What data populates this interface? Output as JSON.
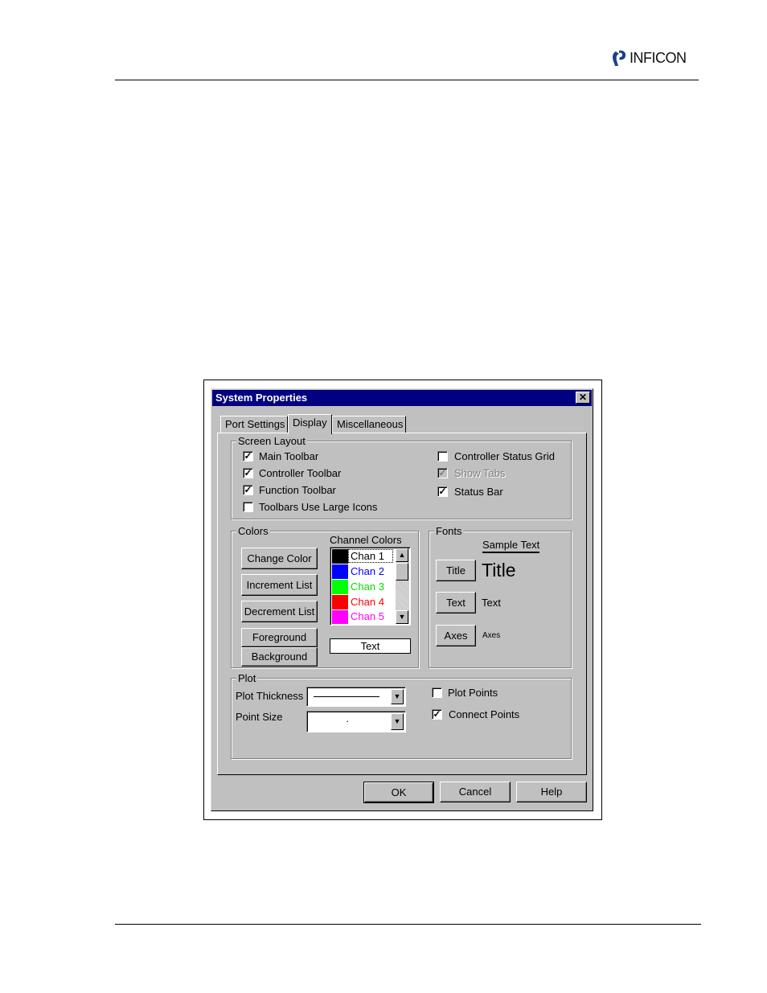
{
  "header": {
    "logo_text": "INFICON"
  },
  "dialog": {
    "title": "System Properties",
    "close_symbol": "✕",
    "tabs": [
      "Port Settings",
      "Display",
      "Miscellaneous"
    ],
    "active_tab": "Display",
    "screen_layout": {
      "legend": "Screen Layout",
      "left_options": [
        {
          "label": "Main Toolbar",
          "checked": true
        },
        {
          "label": "Controller Toolbar",
          "checked": true
        },
        {
          "label": "Function Toolbar",
          "checked": true
        },
        {
          "label": "Toolbars Use Large Icons",
          "checked": false
        }
      ],
      "right_options": [
        {
          "label": "Controller Status Grid",
          "checked": false
        },
        {
          "label": "Show Tabs",
          "checked": true,
          "disabled": true
        },
        {
          "label": "Status Bar",
          "checked": true
        }
      ]
    },
    "colors": {
      "legend": "Colors",
      "buttons": [
        "Change Color",
        "Increment List",
        "Decrement List"
      ],
      "foreground_label": "Foreground",
      "background_label": "Background",
      "channel_colors_label": "Channel Colors",
      "channels": [
        {
          "name": "Chan 1",
          "color": "#000000",
          "text_color": "#000000"
        },
        {
          "name": "Chan 2",
          "color": "#0000ff",
          "text_color": "#0000ff"
        },
        {
          "name": "Chan 3",
          "color": "#00ff00",
          "text_color": "#00dd00"
        },
        {
          "name": "Chan 4",
          "color": "#ff0000",
          "text_color": "#ff0000"
        },
        {
          "name": "Chan 5",
          "color": "#ff00ff",
          "text_color": "#ff00ff"
        }
      ],
      "text_preview": "Text"
    },
    "fonts": {
      "legend": "Fonts",
      "sample_heading": "Sample Text",
      "rows": [
        {
          "button": "Title",
          "sample": "Title"
        },
        {
          "button": "Text",
          "sample": "Text"
        },
        {
          "button": "Axes",
          "sample": "Axes"
        }
      ]
    },
    "plot": {
      "legend": "Plot",
      "thickness_label": "Plot Thickness",
      "point_size_label": "Point Size",
      "point_size_value": "·",
      "options": [
        {
          "label": "Plot Points",
          "checked": false
        },
        {
          "label": "Connect Points",
          "checked": true
        }
      ]
    },
    "footer_buttons": {
      "ok": "OK",
      "cancel": "Cancel",
      "help": "Help"
    }
  }
}
